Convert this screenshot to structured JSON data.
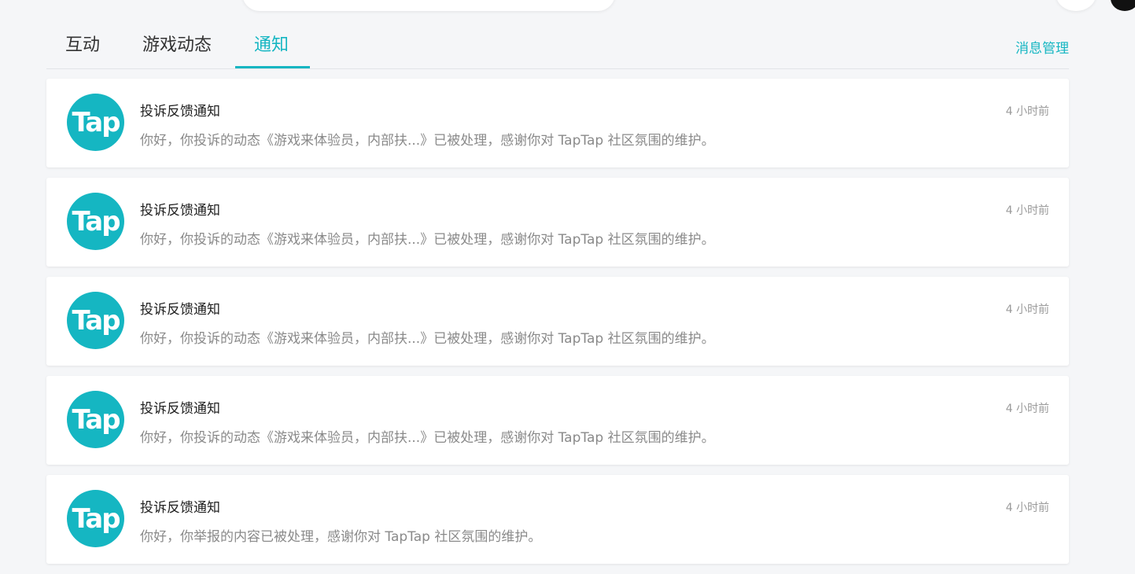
{
  "tabs": [
    {
      "label": "互动"
    },
    {
      "label": "游戏动态"
    },
    {
      "label": "通知"
    }
  ],
  "active_tab": "通知",
  "manage_label": "消息管理",
  "avatar_text": "Tap",
  "notifications": [
    {
      "title": "投诉反馈通知",
      "body": "你好，你投诉的动态《游戏来体验员，内部扶...》已被处理，感谢你对 TapTap 社区氛围的维护。",
      "time": "4 小时前"
    },
    {
      "title": "投诉反馈通知",
      "body": "你好，你投诉的动态《游戏来体验员，内部扶...》已被处理，感谢你对 TapTap 社区氛围的维护。",
      "time": "4 小时前"
    },
    {
      "title": "投诉反馈通知",
      "body": "你好，你投诉的动态《游戏来体验员，内部扶...》已被处理，感谢你对 TapTap 社区氛围的维护。",
      "time": "4 小时前"
    },
    {
      "title": "投诉反馈通知",
      "body": "你好，你投诉的动态《游戏来体验员，内部扶...》已被处理，感谢你对 TapTap 社区氛围的维护。",
      "time": "4 小时前"
    },
    {
      "title": "投诉反馈通知",
      "body": "你好，你举报的内容已被处理，感谢你对 TapTap 社区氛围的维护。",
      "time": "4 小时前"
    }
  ],
  "colors": {
    "accent": "#15b6c2",
    "background": "#f5f6f8"
  }
}
